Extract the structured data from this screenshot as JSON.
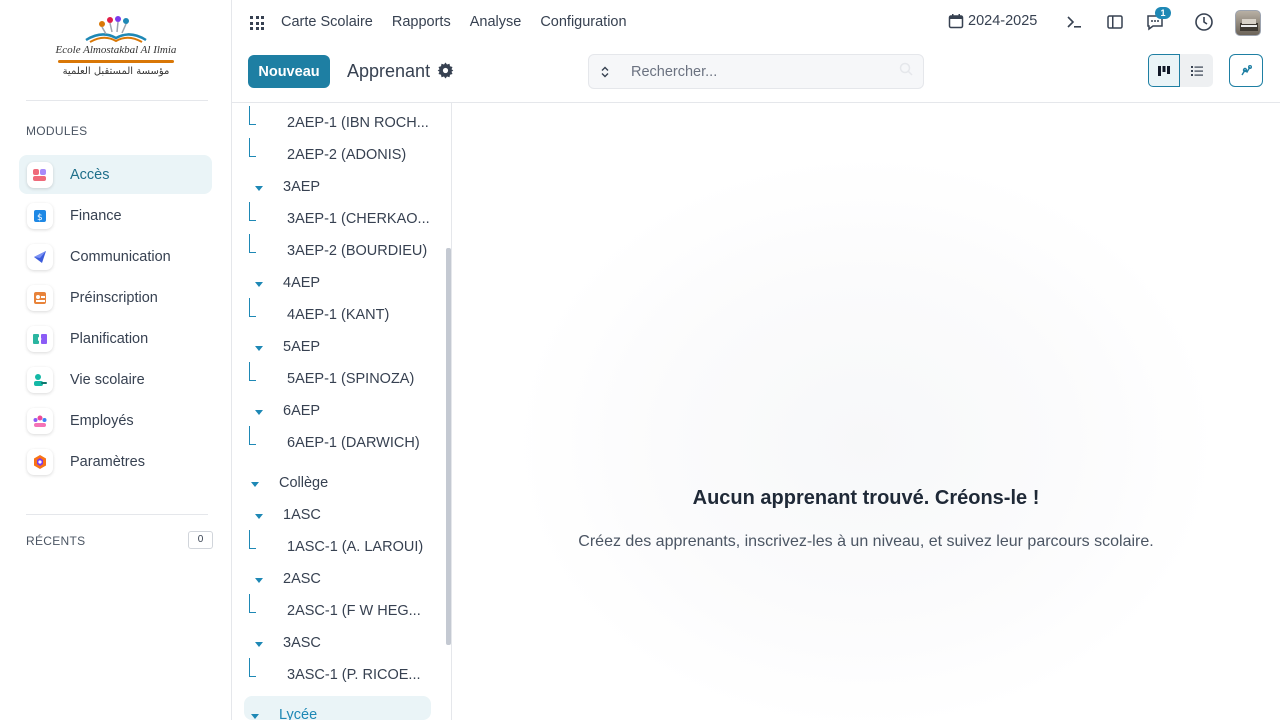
{
  "sidebar": {
    "logo": {
      "name_latin": "Ecole Almostakbal Al Ilmia",
      "name_arabic": "مؤسسة المستقبل العلمية"
    },
    "modules_label": "MODULES",
    "modules": [
      {
        "label": "Accès",
        "icon": "access-icon",
        "active": true
      },
      {
        "label": "Finance",
        "icon": "finance-icon"
      },
      {
        "label": "Communication",
        "icon": "communication-icon"
      },
      {
        "label": "Préinscription",
        "icon": "preinscription-icon"
      },
      {
        "label": "Planification",
        "icon": "planification-icon"
      },
      {
        "label": "Vie scolaire",
        "icon": "vie-scolaire-icon"
      },
      {
        "label": "Employés",
        "icon": "employees-icon"
      },
      {
        "label": "Paramètres",
        "icon": "settings-icon"
      }
    ],
    "recents_label": "RÉCENTS",
    "recents_count": "0"
  },
  "topbar": {
    "menu": [
      "Carte Scolaire",
      "Rapports",
      "Analyse",
      "Configuration"
    ],
    "year": "2024-2025",
    "messages_badge": "1"
  },
  "controlbar": {
    "new_button": "Nouveau",
    "view_title": "Apprenant",
    "search_placeholder": "Rechercher..."
  },
  "tree": {
    "items": [
      {
        "label": "2AEP-1 (IBN ROCH...",
        "level": 2
      },
      {
        "label": "2AEP-2 (ADONIS)",
        "level": 2
      },
      {
        "label": "3AEP",
        "level": 1
      },
      {
        "label": "3AEP-1 (CHERKAO...",
        "level": 2
      },
      {
        "label": "3AEP-2 (BOURDIEU)",
        "level": 2
      },
      {
        "label": "4AEP",
        "level": 1
      },
      {
        "label": "4AEP-1 (KANT)",
        "level": 2
      },
      {
        "label": "5AEP",
        "level": 1
      },
      {
        "label": "5AEP-1 (SPINOZA)",
        "level": 2
      },
      {
        "label": "6AEP",
        "level": 1
      },
      {
        "label": "6AEP-1 (DARWICH)",
        "level": 2
      },
      {
        "label": "Collège",
        "level": 0
      },
      {
        "label": "1ASC",
        "level": 1
      },
      {
        "label": "1ASC-1 (A. LAROUI)",
        "level": 2
      },
      {
        "label": "2ASC",
        "level": 1
      },
      {
        "label": "2ASC-1 (F W HEG...",
        "level": 2
      },
      {
        "label": "3ASC",
        "level": 1
      },
      {
        "label": "3ASC-1 (P. RICOE...",
        "level": 2
      },
      {
        "label": "Lycée",
        "level": 0,
        "selected": true
      }
    ]
  },
  "empty_state": {
    "title": "Aucun apprenant trouvé. Créons-le !",
    "subtitle": "Créez des apprenants, inscrivez-les à un niveau, et suivez leur parcours scolaire."
  },
  "colors": {
    "accent": "#1e7fa3",
    "tree_line": "#1e88b5",
    "active_bg": "#eaf4f7"
  }
}
